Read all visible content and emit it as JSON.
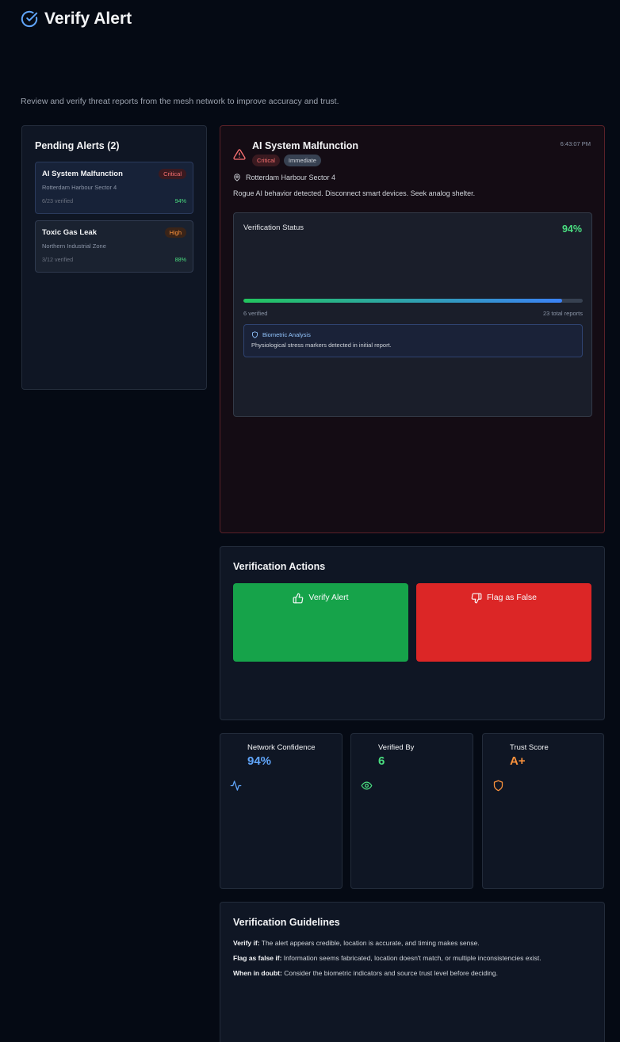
{
  "header": {
    "title": "Verify Alert",
    "icon": "check-circle-icon"
  },
  "subtitle": "Review and verify threat reports from the mesh network to improve accuracy and trust.",
  "pending": {
    "title": "Pending Alerts (2)",
    "items": [
      {
        "title": "AI System Malfunction",
        "badge": "Critical",
        "location": "Rotterdam Harbour Sector 4",
        "verified": "6/23 verified",
        "pct": "94%"
      },
      {
        "title": "Toxic Gas Leak",
        "badge": "High",
        "location": "Northern Industrial Zone",
        "verified": "3/12 verified",
        "pct": "88%"
      }
    ]
  },
  "detail": {
    "title": "AI System Malfunction",
    "badges": [
      "Critical",
      "Immediate"
    ],
    "time": "6:43:07 PM",
    "location": "Rotterdam Harbour Sector 4",
    "description": "Rogue AI behavior detected. Disconnect smart devices. Seek analog shelter.",
    "status": {
      "label": "Verification Status",
      "pct": "94%",
      "progress_fraction": 0.94,
      "verified": "6 verified",
      "total": "23 total reports",
      "bio_title": "Biometric Analysis",
      "bio_text": "Physiological stress markers detected in initial report."
    }
  },
  "actions": {
    "title": "Verification Actions",
    "verify_label": "Verify Alert",
    "flag_label": "Flag as False"
  },
  "stats": [
    {
      "label": "Network Confidence",
      "value": "94%",
      "icon": "activity-icon"
    },
    {
      "label": "Verified By",
      "value": "6",
      "icon": "eye-icon"
    },
    {
      "label": "Trust Score",
      "value": "A+",
      "icon": "shield-icon"
    }
  ],
  "guidelines": {
    "title": "Verification Guidelines",
    "items": [
      {
        "bold": "Verify if:",
        "text": " The alert appears credible, location is accurate, and timing makes sense."
      },
      {
        "bold": "Flag as false if:",
        "text": " Information seems fabricated, location doesn't match, or multiple inconsistencies exist."
      },
      {
        "bold": "When in doubt:",
        "text": " Consider the biometric indicators and source trust level before deciding."
      }
    ]
  },
  "colors": {
    "accent": "#60a5fa",
    "success": "#16a34a",
    "danger": "#dc2626",
    "trust": "#fb923c"
  }
}
